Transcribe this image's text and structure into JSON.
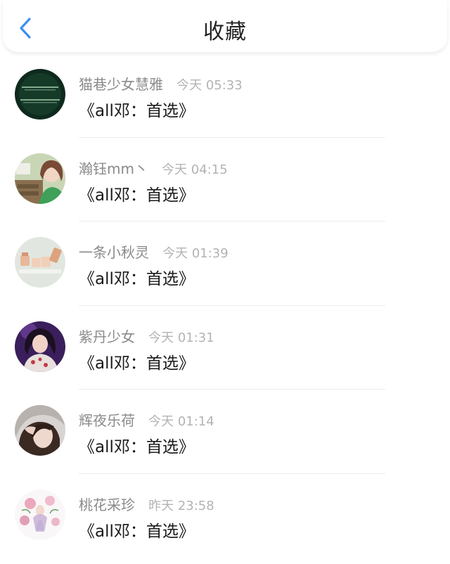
{
  "header": {
    "title": "收藏"
  },
  "items": [
    {
      "name": "猫巷少女慧雅",
      "time": "今天 05:33",
      "collection": "《all邓：首选》"
    },
    {
      "name": "瀚钰mm丶",
      "time": "今天 04:15",
      "collection": "《all邓：首选》"
    },
    {
      "name": "一条小秋灵",
      "time": "今天 01:39",
      "collection": "《all邓：首选》"
    },
    {
      "name": "紫丹少女",
      "time": "今天 01:31",
      "collection": "《all邓：首选》"
    },
    {
      "name": "辉夜乐荷",
      "time": "今天 01:14",
      "collection": "《all邓：首选》"
    },
    {
      "name": "桃花采珍",
      "time": "昨天 23:58",
      "collection": "《all邓：首选》"
    }
  ],
  "colors": {
    "accent": "#3d8ef0",
    "name_text": "#8a8a8a",
    "time_text": "#b3b3b3",
    "body_text": "#1a1a1a"
  }
}
